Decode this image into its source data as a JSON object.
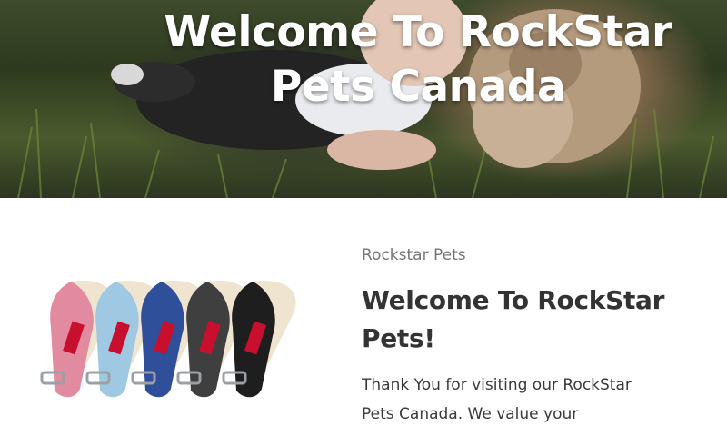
{
  "hero": {
    "title": "Welcome To RockStar Pets Canada"
  },
  "product": {
    "collar_brand_text": "RockStar",
    "collar_colors": [
      "#e28aa0",
      "#9fc8e3",
      "#2f4f9a",
      "#3f3f3f",
      "#1e1e1e"
    ]
  },
  "content": {
    "eyebrow": "Rockstar Pets",
    "heading": "Welcome To RockStar Pets!",
    "body": "Thank You for visiting our RockStar Pets Canada. We value your"
  }
}
